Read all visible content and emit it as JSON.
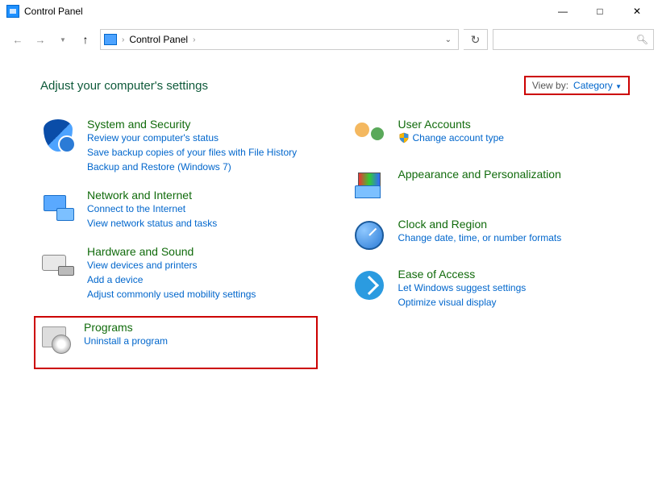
{
  "window": {
    "title": "Control Panel"
  },
  "address": {
    "location": "Control Panel"
  },
  "search": {
    "placeholder": ""
  },
  "heading": "Adjust your computer's settings",
  "viewby": {
    "label": "View by:",
    "value": "Category"
  },
  "categories": {
    "system_security": {
      "title": "System and Security",
      "links": [
        "Review your computer's status",
        "Save backup copies of your files with File History",
        "Backup and Restore (Windows 7)"
      ]
    },
    "network": {
      "title": "Network and Internet",
      "links": [
        "Connect to the Internet",
        "View network status and tasks"
      ]
    },
    "hardware": {
      "title": "Hardware and Sound",
      "links": [
        "View devices and printers",
        "Add a device",
        "Adjust commonly used mobility settings"
      ]
    },
    "programs": {
      "title": "Programs",
      "links": [
        "Uninstall a program"
      ]
    },
    "user_accounts": {
      "title": "User Accounts",
      "links": [
        "Change account type"
      ]
    },
    "appearance": {
      "title": "Appearance and Personalization",
      "links": []
    },
    "clock": {
      "title": "Clock and Region",
      "links": [
        "Change date, time, or number formats"
      ]
    },
    "ease": {
      "title": "Ease of Access",
      "links": [
        "Let Windows suggest settings",
        "Optimize visual display"
      ]
    }
  }
}
